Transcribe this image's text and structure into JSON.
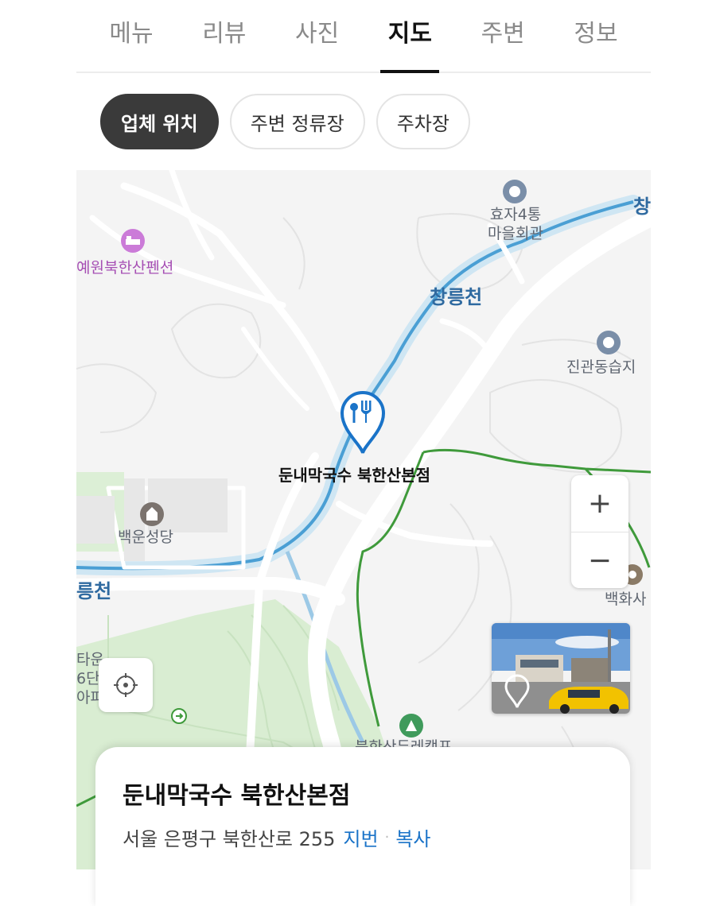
{
  "tabs": [
    {
      "label": "메뉴",
      "active": false
    },
    {
      "label": "리뷰",
      "active": false
    },
    {
      "label": "사진",
      "active": false
    },
    {
      "label": "지도",
      "active": true
    },
    {
      "label": "주변",
      "active": false
    },
    {
      "label": "정보",
      "active": false
    }
  ],
  "chips": [
    {
      "label": "업체 위치",
      "active": true
    },
    {
      "label": "주변 정류장",
      "active": false
    },
    {
      "label": "주차장",
      "active": false
    }
  ],
  "map": {
    "labels": {
      "hyoja_line1": "효자4통",
      "hyoja_line2": "마을회관",
      "pension": "예원북한산펜션",
      "river_main": "창릉천",
      "river_right": "창",
      "river_left": "릉천",
      "jingwan": "진관동습지",
      "church": "백운성당",
      "baekhwa": "백화사",
      "left_edge_1": "타운",
      "left_edge_2": "6단",
      "left_edge_3": "아파",
      "camp": "북한산두레캠프"
    },
    "marker_label": "둔내막국수 북한산본점",
    "zoom_in": "+",
    "zoom_out": "−",
    "icons": [
      "restaurant-pin-icon",
      "poi-circle-icon",
      "pension-bed-icon",
      "church-icon",
      "temple-icon",
      "camp-icon",
      "locate-icon",
      "roadview-pin-icon",
      "trail-arrow-icon"
    ]
  },
  "card": {
    "title": "둔내막국수 북한산본점",
    "address": "서울 은평구 북한산로 255",
    "jibun_label": "지번",
    "separator": "·",
    "copy_label": "복사"
  },
  "colors": {
    "accent": "#1a73c8",
    "river": "#4a9fd4",
    "green_area": "#dcefd6",
    "trail": "#3f9a3b"
  }
}
